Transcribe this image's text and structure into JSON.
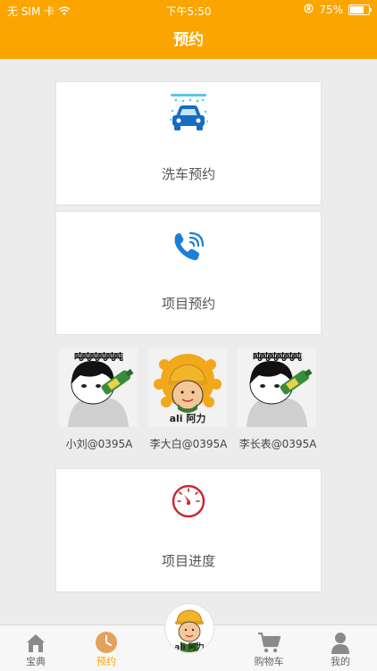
{
  "status_bar": {
    "carrier": "无 SIM 卡",
    "time": "下午5:50",
    "battery_text": "75%",
    "battery_level": 0.75
  },
  "header": {
    "title": "预约"
  },
  "cards": {
    "car_wash": {
      "label": "洗车预约",
      "icon": "car-wash-icon"
    },
    "project_booking": {
      "label": "项目预约",
      "icon": "phone-call-icon"
    },
    "project_progress": {
      "label": "项目进度",
      "icon": "gauge-icon"
    }
  },
  "persons": [
    {
      "name": "小刘@0395A",
      "avatar": "meme-avatar",
      "overlay": "吨吨吨吨吨吨"
    },
    {
      "name": "李大白@0395A",
      "avatar": "worker-avatar",
      "logo": "ali 阿力"
    },
    {
      "name": "李长表@0395A",
      "avatar": "meme-avatar",
      "overlay": "吨吨吨吨吨吨"
    }
  ],
  "tabbar": {
    "items": [
      {
        "label": "宝典",
        "icon": "house-icon"
      },
      {
        "label": "预约",
        "icon": "clock-icon",
        "active": true
      },
      {
        "label": "购物车",
        "icon": "cart-icon"
      },
      {
        "label": "我的",
        "icon": "person-icon"
      }
    ],
    "center_logo": "ali 阿力"
  },
  "colors": {
    "accent": "#fba501",
    "icon_blue": "#1a7fd6",
    "gauge_red": "#c9262c"
  }
}
